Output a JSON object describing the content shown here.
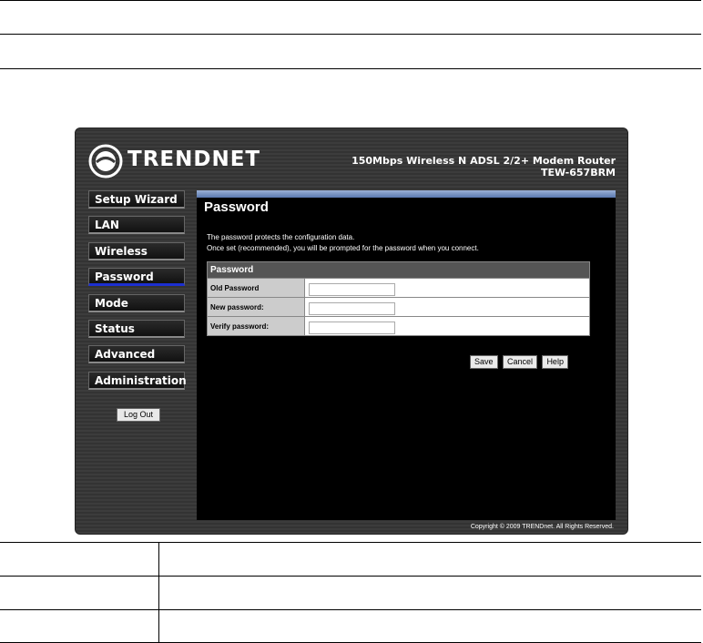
{
  "header": {
    "brand": "TRENDNET",
    "product_line1": "150Mbps Wireless N ADSL 2/2+ Modem Router",
    "product_line2": "TEW-657BRM",
    "logo_icon": "trendnet-logo-icon"
  },
  "nav": {
    "items": [
      {
        "label": "Setup Wizard"
      },
      {
        "label": "LAN"
      },
      {
        "label": "Wireless"
      },
      {
        "label": "Password"
      },
      {
        "label": "Mode"
      },
      {
        "label": "Status"
      },
      {
        "label": "Advanced"
      },
      {
        "label": "Administration"
      }
    ],
    "logout_label": "Log Out"
  },
  "content": {
    "title": "Password",
    "desc1": "The password protects the configuration data.",
    "desc2": "Once set (recommended), you will be prompted for the password when you connect.",
    "table": {
      "header": "Password",
      "rows": [
        {
          "label": "Old Password",
          "value": ""
        },
        {
          "label": "New password:",
          "value": ""
        },
        {
          "label": "Verify password:",
          "value": ""
        }
      ]
    },
    "buttons": {
      "save": "Save",
      "cancel": "Cancel",
      "help": "Help"
    }
  },
  "footer": {
    "copyright": "Copyright © 2009 TRENDnet. All Rights Reserved."
  }
}
